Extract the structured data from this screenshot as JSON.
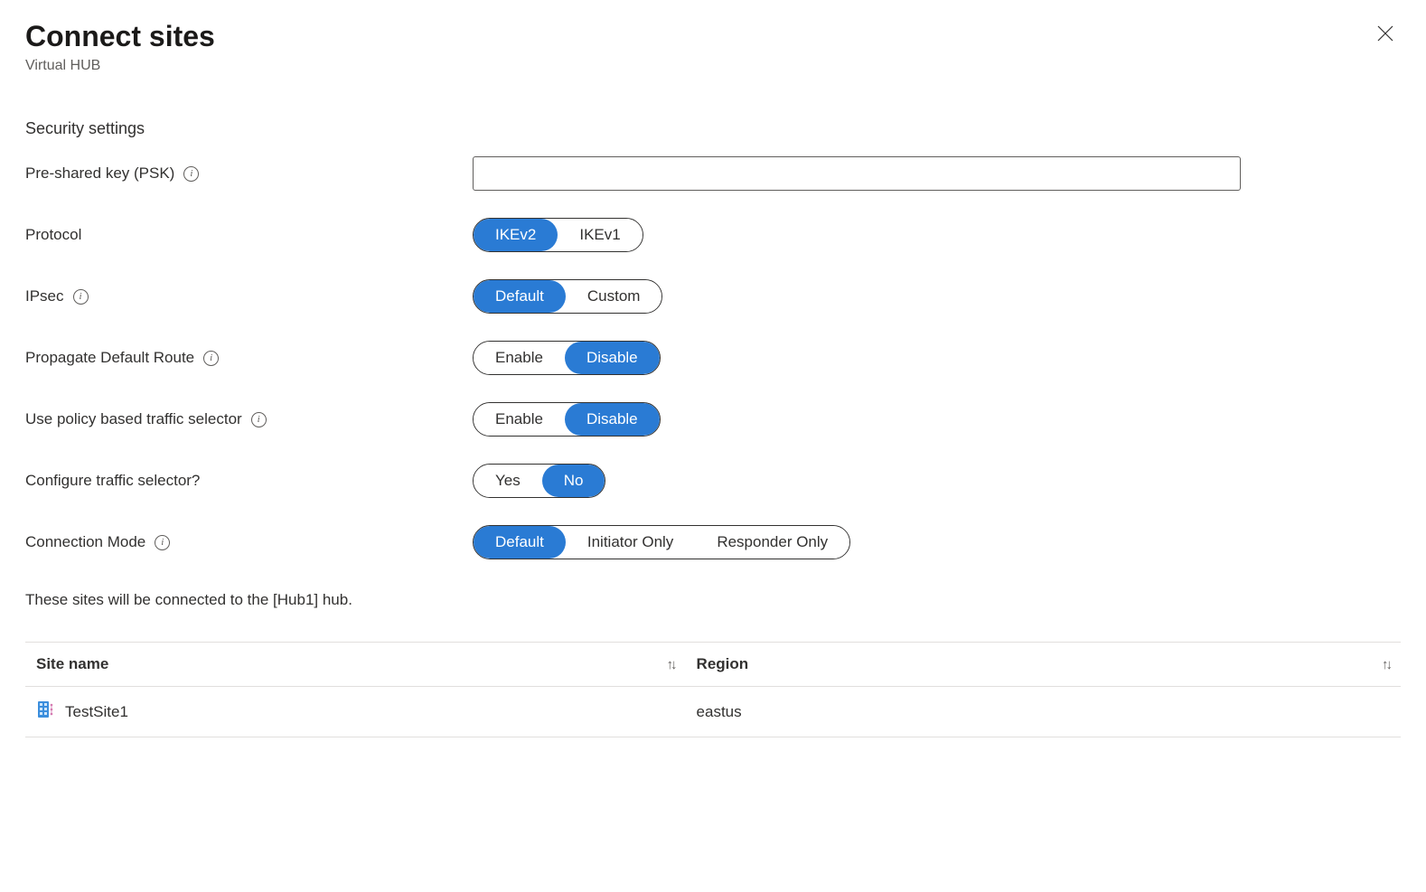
{
  "header": {
    "title": "Connect sites",
    "subtitle": "Virtual HUB"
  },
  "sectionTitle": "Security settings",
  "fields": {
    "psk": {
      "label": "Pre-shared key (PSK)",
      "value": ""
    },
    "protocol": {
      "label": "Protocol",
      "options": [
        "IKEv2",
        "IKEv1"
      ],
      "selected": "IKEv2"
    },
    "ipsec": {
      "label": "IPsec",
      "options": [
        "Default",
        "Custom"
      ],
      "selected": "Default"
    },
    "propagateDefault": {
      "label": "Propagate Default Route",
      "options": [
        "Enable",
        "Disable"
      ],
      "selected": "Disable"
    },
    "policySelector": {
      "label": "Use policy based traffic selector",
      "options": [
        "Enable",
        "Disable"
      ],
      "selected": "Disable"
    },
    "configureSelector": {
      "label": "Configure traffic selector?",
      "options": [
        "Yes",
        "No"
      ],
      "selected": "No"
    },
    "connectionMode": {
      "label": "Connection Mode",
      "options": [
        "Default",
        "Initiator Only",
        "Responder Only"
      ],
      "selected": "Default"
    }
  },
  "caption": "These sites will be connected to the [Hub1] hub.",
  "table": {
    "columns": [
      "Site name",
      "Region"
    ],
    "rows": [
      {
        "siteName": "TestSite1",
        "region": "eastus"
      }
    ]
  }
}
